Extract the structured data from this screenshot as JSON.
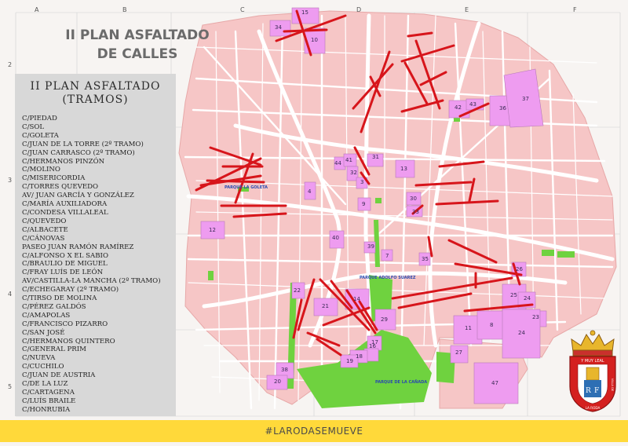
{
  "map": {
    "title_line1": "II PLAN ASFALTADO",
    "title_line2": "DE CALLES",
    "grid_columns": [
      "A",
      "B",
      "C",
      "D",
      "E",
      "F"
    ],
    "grid_rows": [
      "2",
      "3",
      "4",
      "5"
    ],
    "colors": {
      "urban_block": "#f6c6c6",
      "park": "#6fd23f",
      "facility": "#ee9cf0",
      "paving_line": "#d7151b",
      "footer": "#ffd93a",
      "panel": "#d8d8d8"
    }
  },
  "panel": {
    "title_line1": "II PLAN ASFALTADO",
    "title_line2": "(TRAMOS)",
    "streets": [
      "C/PIEDAD",
      "C/SOL",
      "C/GOLETA",
      "C/JUAN DE LA TORRE (2º TRAMO)",
      "C/JUAN CARRASCO (2º TRAMO)",
      "C/HERMANOS PINZÓN",
      "C/MOLINO",
      "C/MISERICORDIA",
      "C/TORRES QUEVEDO",
      "AV/ JUAN GARCÍA Y GONZÁLEZ",
      "C/MARÍA AUXILIADORA",
      "C/CONDESA VILLALEAL",
      "C/QUEVEDO",
      "C/ALBACETE",
      "C/CÁNOVAS",
      "PASEO JUAN RAMÓN RAMÍREZ",
      "C/ALFONSO X EL SABIO",
      "C/BRAULIO DE MIGUEL",
      "C/FRAY LUÍS DE LEÓN",
      "AV/CASTILLA-LA MANCHA (2º TRAMO)",
      "C/ECHEGARAY (2º TRAMO)",
      "C/TIRSO DE MOLINA",
      "C/PÉREZ GALDÓS",
      "C/AMAPOLAS",
      "C/FRANCISCO PIZARRO",
      "C/SAN JOSÉ",
      "C/HERMANOS QUINTERO",
      "C/GENERAL PRIM",
      "C/NUEVA",
      "C/CUCHILO",
      "C/JUAN DE AUSTRIA",
      "C/DE LA LUZ",
      "C/CARTAGENA",
      "C/LUÍS BRAILE",
      "C/HONRUBIA"
    ]
  },
  "parks": {
    "goleta": "PARQUE LA GOLETA",
    "adolfo_suarez": "PARQUE ADOLFO SUAREZ",
    "canada": "PARQUE DE LA CAÑADA"
  },
  "blocks": {
    "b15": "15",
    "b34": "34",
    "b10": "10",
    "b42": "42",
    "b43": "43",
    "b36": "36",
    "b37": "37",
    "b44": "44",
    "b41": "41",
    "b31": "31",
    "b32": "32",
    "b3": "3",
    "b13": "13",
    "b4": "4",
    "b9": "9",
    "b30": "30",
    "b33": "33",
    "b12": "12",
    "b40": "40",
    "b39": "39",
    "b7": "7",
    "b35": "35",
    "b26": "26",
    "b22": "22",
    "b21": "21",
    "b14": "14",
    "b25": "25",
    "b24a": "24",
    "b23": "23",
    "b29": "29",
    "b11": "11",
    "b8": "8",
    "b24b": "24",
    "b17": "17",
    "b16": "16",
    "b18": "18",
    "b19": "19",
    "b27": "27",
    "b38": "38",
    "b20": "20",
    "b47": "47"
  },
  "footer": {
    "hashtag": "#LARODASEMUEVE"
  },
  "coat_of_arms": {
    "motto": "Y MUY LEAL",
    "side_left": "MUY NOBLE",
    "side_right": "VILLA DE",
    "bottom": "LA RODA",
    "initials_left": "R",
    "initials_right": "F"
  }
}
